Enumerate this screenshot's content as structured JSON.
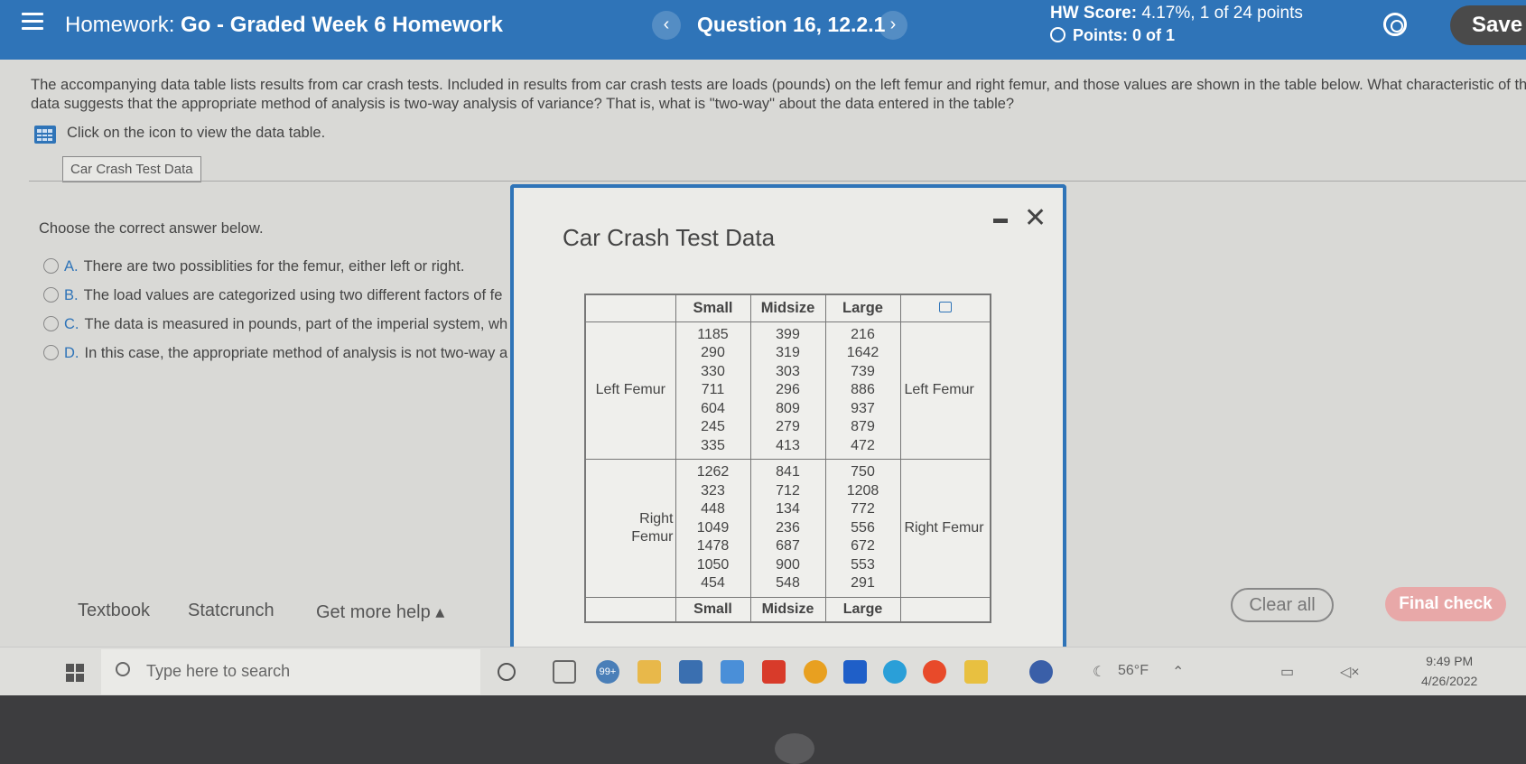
{
  "header": {
    "homework_prefix": "Homework:",
    "homework_name": "Go - Graded Week 6 Homework",
    "prev_glyph": "‹",
    "next_glyph": "›",
    "question_label": "Question 16, 12.2.1",
    "hw_score_label": "HW Score:",
    "hw_score_value": "4.17%, 1 of 24 points",
    "points_text": "Points: 0 of 1",
    "save_label": "Save"
  },
  "question": {
    "text": "The accompanying data table lists results from car crash tests. Included in results from car crash tests are loads (pounds) on the left femur and right femur, and those values are shown in the table below. What characteristic of th data suggests that the appropriate method of analysis is two-way analysis of variance? That is, what is \"two-way\" about the data entered in the table?",
    "icon_prompt": "Click on the icon to view the data table.",
    "tab_label": "Car Crash Test Data",
    "choose_prompt": "Choose the correct answer below.",
    "choices": [
      {
        "letter": "A.",
        "text": "There are two possiblities for the femur, either left or right."
      },
      {
        "letter": "B.",
        "text": "The load values are categorized using two different factors of fe"
      },
      {
        "letter": "C.",
        "text": "The data is measured in pounds, part of the imperial system, wh"
      },
      {
        "letter": "D.",
        "text": "In this case, the appropriate method of analysis is not two-way a"
      }
    ]
  },
  "footer": {
    "textbook": "Textbook",
    "statcrunch": "Statcrunch",
    "more_help": "Get more help ▴",
    "clear_all": "Clear all",
    "final_check": "Final check"
  },
  "modal": {
    "title": "Car Crash Test Data",
    "close_glyph": "✕",
    "columns": [
      "Small",
      "Midsize",
      "Large"
    ],
    "rows": [
      {
        "label": "Left Femur",
        "side_label": "Left Femur",
        "small": "1185\n290\n330\n711\n604\n245\n335",
        "midsize": "399\n319\n303\n296\n809\n279\n413",
        "large": "216\n1642\n739\n886\n937\n879\n472"
      },
      {
        "label": "Right\nFemur",
        "side_label": "Right Femur",
        "small": "1262\n323\n448\n1049\n1478\n1050\n454",
        "midsize": "841\n712\n134\n236\n687\n900\n548",
        "large": "750\n1208\n772\n556\n672\n553\n291"
      }
    ]
  },
  "taskbar": {
    "search_placeholder": "Type here to search",
    "badge": "99+",
    "temperature": "56°F",
    "time": "9:49 PM",
    "date": "4/26/2022"
  },
  "colors": {
    "header_blue": "#2f74b8",
    "final_check_pink": "#e8a8a8"
  }
}
